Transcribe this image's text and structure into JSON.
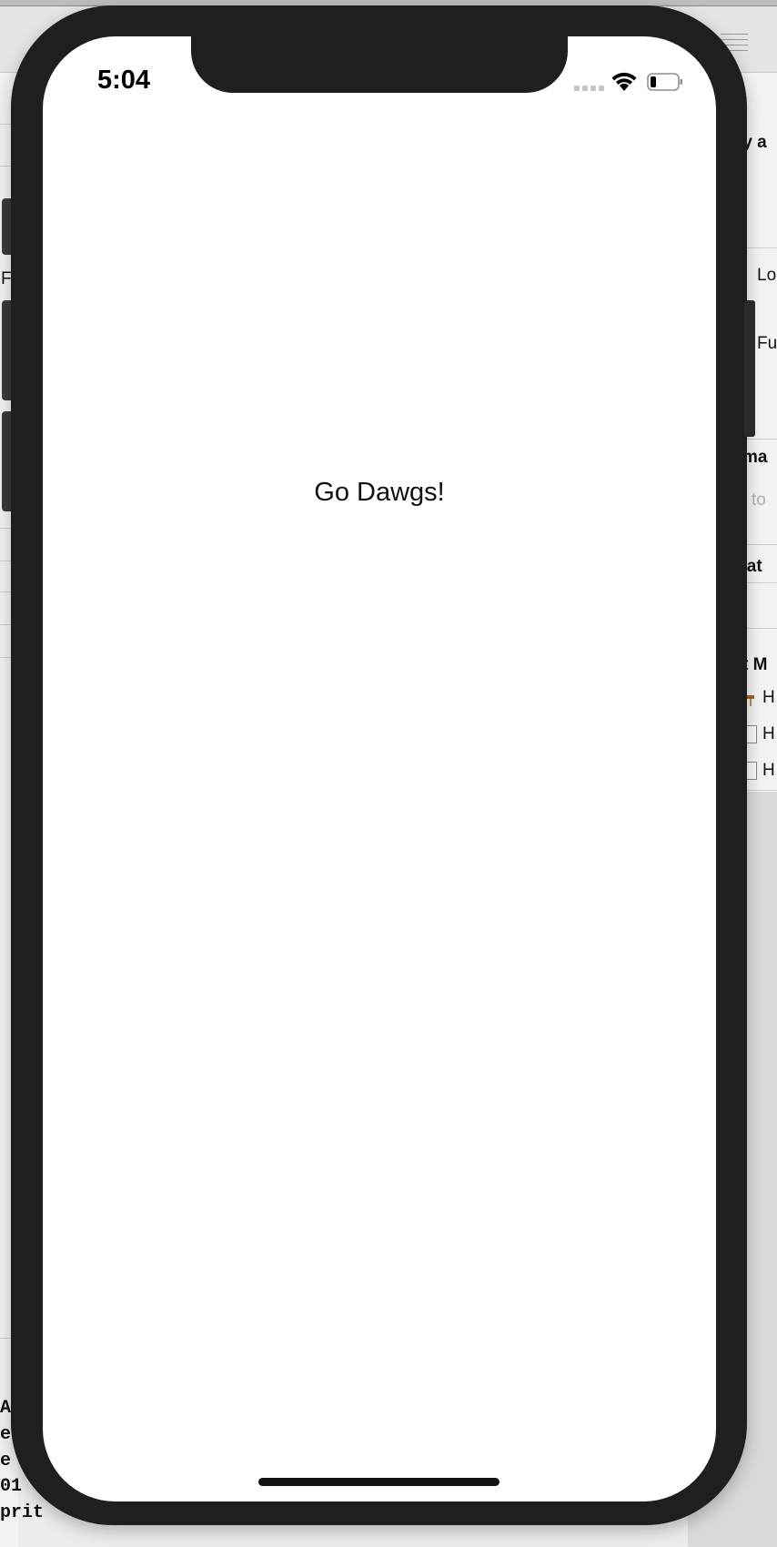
{
  "background_window": {
    "right_panel_fragments": [
      "ty a",
      "Lo",
      "Fu",
      "ma",
      "to",
      "izat",
      "t M",
      "H",
      "H",
      "H"
    ],
    "left_panel_fragments": [
      "F"
    ],
    "console_fragments": [
      "A",
      "e",
      "e",
      "01",
      "prit"
    ]
  },
  "simulator": {
    "status_bar": {
      "time": "5:04",
      "signal": "signal-dots-icon",
      "wifi": "wifi-icon",
      "battery": "battery-low-icon"
    },
    "content": {
      "label": "Go Dawgs!"
    }
  }
}
